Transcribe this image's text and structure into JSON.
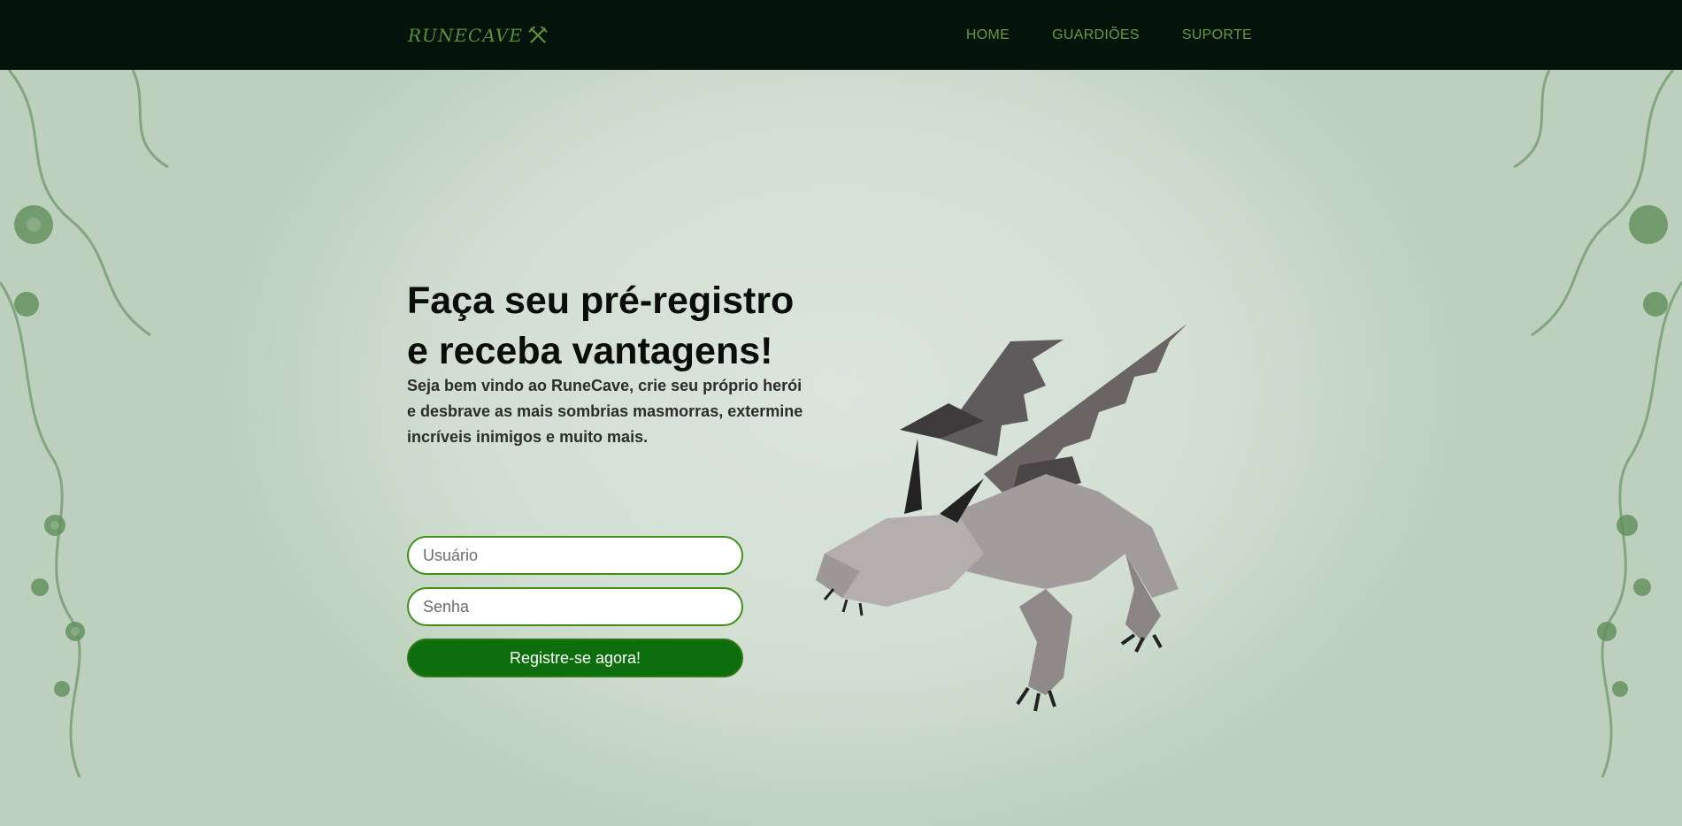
{
  "header": {
    "logo_text": "RUNECAVE",
    "nav": [
      {
        "label": "HOME"
      },
      {
        "label": "GUARDIÕES"
      },
      {
        "label": "SUPORTE"
      }
    ]
  },
  "hero": {
    "title_line1": "Faça seu pré-registro",
    "title_line2": "e receba vantagens!",
    "subtitle": "Seja bem vindo ao RuneCave, crie seu próprio herói e desbrave as mais sombrias masmorras, extermine incríveis inimigos e muito mais."
  },
  "form": {
    "username_placeholder": "Usuário",
    "password_placeholder": "Senha",
    "submit_label": "Registre-se agora!"
  },
  "colors": {
    "topbar": "#04130c",
    "nav_text": "#6b9a3f",
    "accent_green": "#0c6e0c",
    "field_border": "#3f8f1a"
  },
  "icons": [
    "crossed-swords-icon",
    "dragon-illustration",
    "vine-ornament"
  ]
}
